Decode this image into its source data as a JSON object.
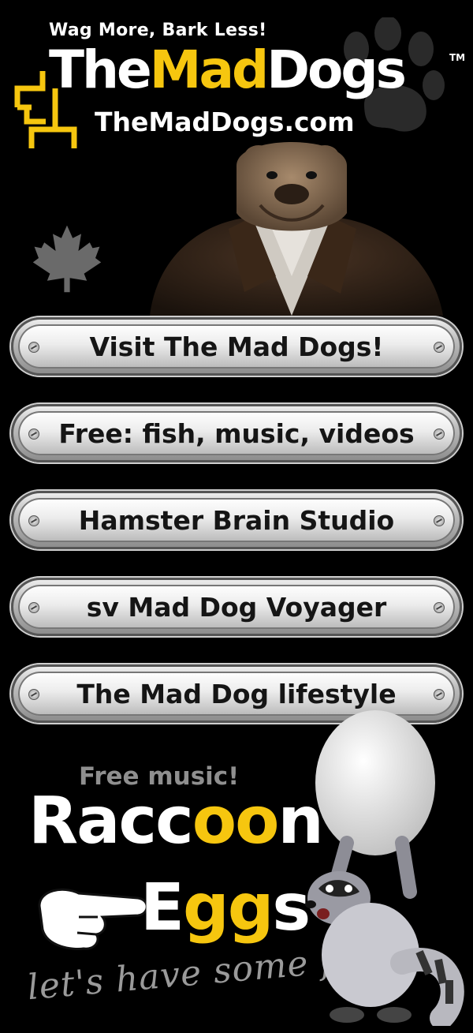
{
  "header": {
    "tagline": "Wag More, Bark Less!",
    "brand": {
      "part1": "The",
      "part2": "Mad",
      "part3": "Dogs",
      "tm": "TM"
    },
    "domain": "TheMadDogs.com"
  },
  "icons": [
    "bracket-logo-icon",
    "paw-icon",
    "bulldog-image",
    "maple-leaf-icon",
    "pointing-hand-icon",
    "raccoon-egg-image"
  ],
  "colors": {
    "accent": "#f6c60f",
    "background": "#000000",
    "promo_text": "#8f8f8f"
  },
  "buttons": [
    {
      "label": "Visit The Mad Dogs!"
    },
    {
      "label": "Free: fish, music, videos"
    },
    {
      "label": "Hamster Brain Studio"
    },
    {
      "label": "sv Mad Dog Voyager"
    },
    {
      "label": "The Mad Dog lifestyle"
    }
  ],
  "promo": {
    "subtitle": "Free music!",
    "title_line1": "Raccoon",
    "title_line2": "Eggs",
    "script": "let's have some fun!"
  }
}
